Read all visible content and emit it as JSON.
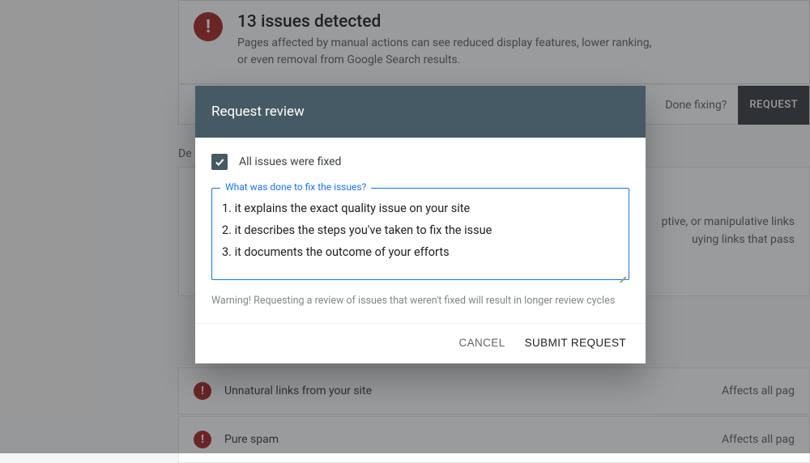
{
  "banner": {
    "title": "13 issues detected",
    "desc": "Pages affected by manual actions can see reduced display features, lower ranking, or even removal from Google Search results."
  },
  "fixbar": {
    "prompt": "Done fixing?",
    "button": "REQUEST"
  },
  "truncated_label": "De",
  "issue_detail": {
    "line1": "ptive, or manipulative links",
    "line2": "uying links that pass"
  },
  "issues": [
    {
      "title": "Unnatural links from your site",
      "right": "Affects all pag"
    },
    {
      "title": "Pure spam",
      "right": "Affects all pag"
    }
  ],
  "modal": {
    "title": "Request review",
    "checkbox_label": "All issues were fixed",
    "field_legend": "What was done to fix the issues?",
    "textarea_value": "1. it explains the exact quality issue on your site\n2. it describes the steps you've taken to fix the issue\n3. it documents the outcome of your efforts",
    "warning": "Warning! Requesting a review of issues that weren't fixed will result in longer review cycles",
    "cancel": "CANCEL",
    "submit": "SUBMIT REQUEST"
  }
}
